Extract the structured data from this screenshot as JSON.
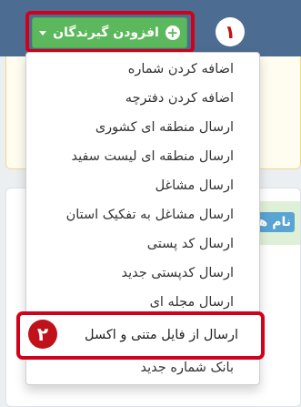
{
  "header": {
    "add_button_label": "افزودن گیرندگان",
    "add_button_icon": "plus-circle-icon",
    "caret_icon": "caret-down-icon"
  },
  "steps": {
    "step1": "۱",
    "step2": "۲"
  },
  "card": {
    "heading_fragment": "نام های"
  },
  "menu": {
    "items": [
      {
        "label": "اضافه کردن شماره"
      },
      {
        "label": "اضافه کردن دفترچه"
      },
      {
        "label": "ارسال منطقه ای کشوری"
      },
      {
        "label": "ارسال منطقه ای لیست سفید"
      },
      {
        "label": "ارسال مشاغل"
      },
      {
        "label": "ارسال مشاغل به تفکیک استان"
      },
      {
        "label": "ارسال کد پستی"
      },
      {
        "label": "ارسال کدپستی جدید"
      },
      {
        "label": "ارسال مجله ای"
      },
      {
        "label": "ارسال از فایل متنی و اکسل"
      },
      {
        "label": "بانک شماره جدید"
      }
    ]
  },
  "colors": {
    "header": "#4d6c92",
    "success": "#5cb85c",
    "annotation": "#d0021b"
  }
}
